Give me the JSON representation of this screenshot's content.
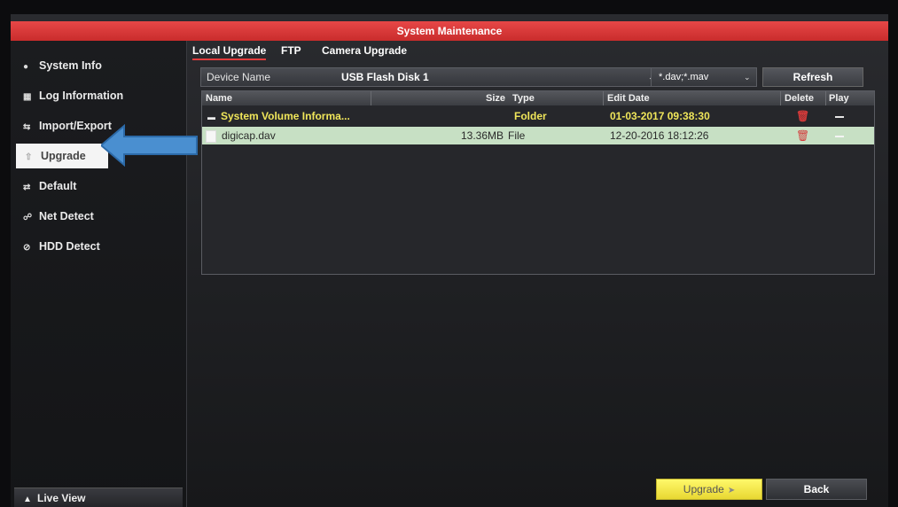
{
  "window": {
    "title": "System Maintenance"
  },
  "sidebar": {
    "items": [
      {
        "label": "System Info",
        "icon": "info-dot-icon"
      },
      {
        "label": "Log Information",
        "icon": "log-icon"
      },
      {
        "label": "Import/Export",
        "icon": "import-export-icon"
      },
      {
        "label": "Upgrade",
        "icon": "upgrade-icon",
        "active": true
      },
      {
        "label": "Default",
        "icon": "default-icon"
      },
      {
        "label": "Net Detect",
        "icon": "network-icon"
      },
      {
        "label": "HDD Detect",
        "icon": "hdd-icon"
      }
    ],
    "live_view": "Live View"
  },
  "tabs": [
    {
      "label": "Local Upgrade",
      "active": true
    },
    {
      "label": "FTP"
    },
    {
      "label": "Camera Upgrade"
    }
  ],
  "device": {
    "label": "Device Name",
    "value": "USB Flash Disk 1",
    "filter": "*.dav;*.mav",
    "refresh_label": "Refresh"
  },
  "table": {
    "headers": {
      "name": "Name",
      "size": "Size",
      "type": "Type",
      "edit_date": "Edit Date",
      "delete": "Delete",
      "play": "Play"
    },
    "rows": [
      {
        "name": "System Volume Informa...",
        "size": "",
        "type": "Folder",
        "edit_date": "01-03-2017 09:38:30"
      },
      {
        "name": "digicap.dav",
        "size": "13.36MB",
        "type": "File",
        "edit_date": "12-20-2016 18:12:26"
      }
    ]
  },
  "actions": {
    "upgrade_label": "Upgrade",
    "back_label": "Back"
  },
  "colors": {
    "title_bar": "#d63636",
    "selected_row": "#c7e0c4",
    "folder_text": "#f0e65a",
    "upgrade_button": "#f3e84a",
    "arrow": "#4a8fd0"
  }
}
